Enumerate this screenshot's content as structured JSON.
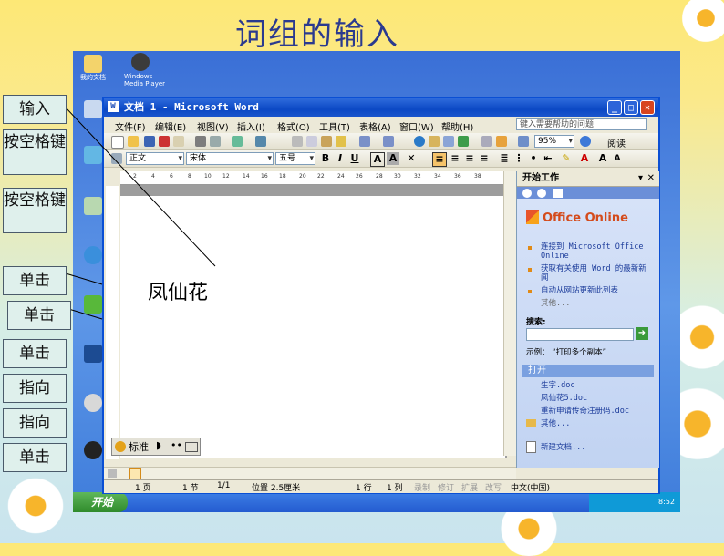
{
  "slide": {
    "title": "词组的输入"
  },
  "side_labels": [
    "输入",
    "按空格键",
    "按空格键",
    "单击",
    "单击",
    "单击",
    "指向",
    "指向",
    "单击"
  ],
  "word": {
    "title": "文档 1 - Microsoft Word",
    "menu": [
      "文件(F)",
      "编辑(E)",
      "视图(V)",
      "插入(I)",
      "格式(O)",
      "工具(T)",
      "表格(A)",
      "窗口(W)",
      "帮助(H)"
    ],
    "help_placeholder": "键入需要帮助的问题",
    "zoom": "95%",
    "read_label": "阅读",
    "style": "正文",
    "font": "宋体",
    "size": "五号",
    "ruler_ticks": [
      "2",
      "4",
      "6",
      "8",
      "10",
      "12",
      "14",
      "16",
      "18",
      "20",
      "22",
      "24",
      "26",
      "28",
      "30",
      "32",
      "34",
      "36",
      "38"
    ],
    "document_text": "凤仙花",
    "status": {
      "page": "1 页",
      "section": "1 节",
      "pages": "1/1",
      "position": "位置 2.5厘米",
      "line": "1 行",
      "column": "1 列",
      "rec": "录制",
      "trk": "修订",
      "ext": "扩展",
      "ovr": "改写",
      "lang": "中文(中国)"
    }
  },
  "task_pane": {
    "title": "开始工作",
    "brand": "Office Online",
    "links": [
      "连接到 Microsoft Office Online",
      "获取有关使用 Word 的最新新闻",
      "自动从网站更新此列表"
    ],
    "more": "其他...",
    "search_label": "搜索:",
    "example": "示例：  “打印多个副本”",
    "open_section": "打开",
    "files": [
      "生字.doc",
      "凤仙花5.doc",
      "重新申请传奇注册码.doc"
    ],
    "open_more": "其他...",
    "new_doc": "新建文档..."
  },
  "ime": {
    "label": "标准"
  },
  "taskbar": {
    "start": "开始",
    "clock": "8:52"
  },
  "desktop_labels": [
    "我的文档",
    "Windows Media Player",
    "我的电脑",
    "网上邻居",
    "回收站",
    "Internet Explorer",
    "360安全卫士",
    "暴风影音",
    "QQ"
  ]
}
